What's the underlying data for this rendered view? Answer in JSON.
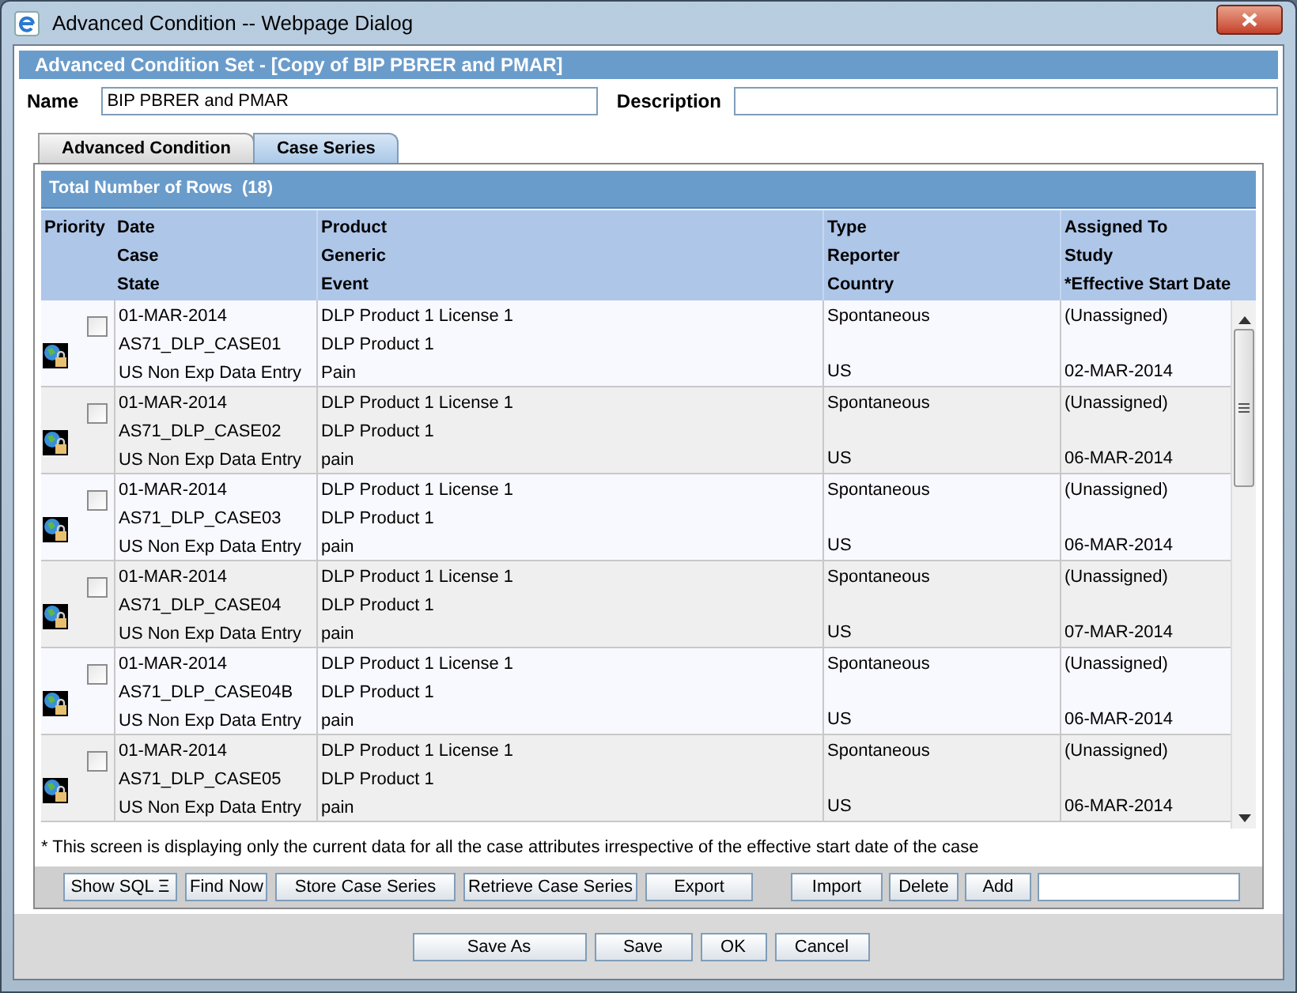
{
  "window": {
    "title": "Advanced Condition -- Webpage Dialog"
  },
  "header": {
    "title": "Advanced Condition Set - [Copy of BIP PBRER and PMAR]"
  },
  "form": {
    "name_label": "Name",
    "name_value": "BIP PBRER and PMAR",
    "description_label": "Description"
  },
  "tabs": [
    {
      "label": "Advanced Condition",
      "selected": false
    },
    {
      "label": "Case Series",
      "selected": true
    }
  ],
  "table": {
    "title": "Total Number of Rows  (18)",
    "columns": [
      {
        "lines": [
          "Priority"
        ]
      },
      {
        "lines": [
          "Date",
          "Case",
          "State"
        ]
      },
      {
        "lines": [
          "Product",
          "Generic",
          "Event"
        ]
      },
      {
        "lines": [
          "Type",
          "Reporter",
          "Country"
        ]
      },
      {
        "lines": [
          "Assigned To",
          "Study",
          "*Effective Start Date"
        ]
      }
    ],
    "rows": [
      {
        "checked": false,
        "date": "01-MAR-2014",
        "case": "AS71_DLP_CASE01",
        "state": "US Non Exp Data Entry",
        "product": "DLP Product 1 License 1",
        "generic": "DLP Product 1",
        "event": "Pain",
        "type": "Spontaneous",
        "country": "US",
        "assigned_to": "(Unassigned)",
        "effective_start_date": "02-MAR-2014"
      },
      {
        "checked": false,
        "date": "01-MAR-2014",
        "case": "AS71_DLP_CASE02",
        "state": "US Non Exp Data Entry",
        "product": "DLP Product 1 License 1",
        "generic": "DLP Product 1",
        "event": "pain",
        "type": "Spontaneous",
        "country": "US",
        "assigned_to": "(Unassigned)",
        "effective_start_date": "06-MAR-2014"
      },
      {
        "checked": false,
        "date": "01-MAR-2014",
        "case": "AS71_DLP_CASE03",
        "state": "US Non Exp Data Entry",
        "product": "DLP Product 1 License 1",
        "generic": "DLP Product 1",
        "event": "pain",
        "type": "Spontaneous",
        "country": "US",
        "assigned_to": "(Unassigned)",
        "effective_start_date": "06-MAR-2014"
      },
      {
        "checked": false,
        "date": "01-MAR-2014",
        "case": "AS71_DLP_CASE04",
        "state": "US Non Exp Data Entry",
        "product": "DLP Product 1 License 1",
        "generic": "DLP Product 1",
        "event": "pain",
        "type": "Spontaneous",
        "country": "US",
        "assigned_to": "(Unassigned)",
        "effective_start_date": "07-MAR-2014"
      },
      {
        "checked": false,
        "date": "01-MAR-2014",
        "case": "AS71_DLP_CASE04B",
        "state": "US Non Exp Data Entry",
        "product": "DLP Product 1 License 1",
        "generic": "DLP Product 1",
        "event": "pain",
        "type": "Spontaneous",
        "country": "US",
        "assigned_to": "(Unassigned)",
        "effective_start_date": "06-MAR-2014"
      },
      {
        "checked": false,
        "date": "01-MAR-2014",
        "case": "AS71_DLP_CASE05",
        "state": "US Non Exp Data Entry",
        "product": "DLP Product 1 License 1",
        "generic": "DLP Product 1",
        "event": "pain",
        "type": "Spontaneous",
        "country": "US",
        "assigned_to": "(Unassigned)",
        "effective_start_date": "06-MAR-2014"
      }
    ]
  },
  "footnote": "* This screen is displaying only the current data for all the case attributes irrespective of the effective start date of the case",
  "toolbar": {
    "buttons_left": [
      "Show SQL Ξ",
      "Find Now",
      "Store Case Series",
      "Retrieve Case Series",
      "Export"
    ],
    "buttons_right": [
      "Import",
      "Delete",
      "Add"
    ]
  },
  "dialog_buttons": [
    "Save As",
    "Save",
    "OK",
    "Cancel"
  ]
}
